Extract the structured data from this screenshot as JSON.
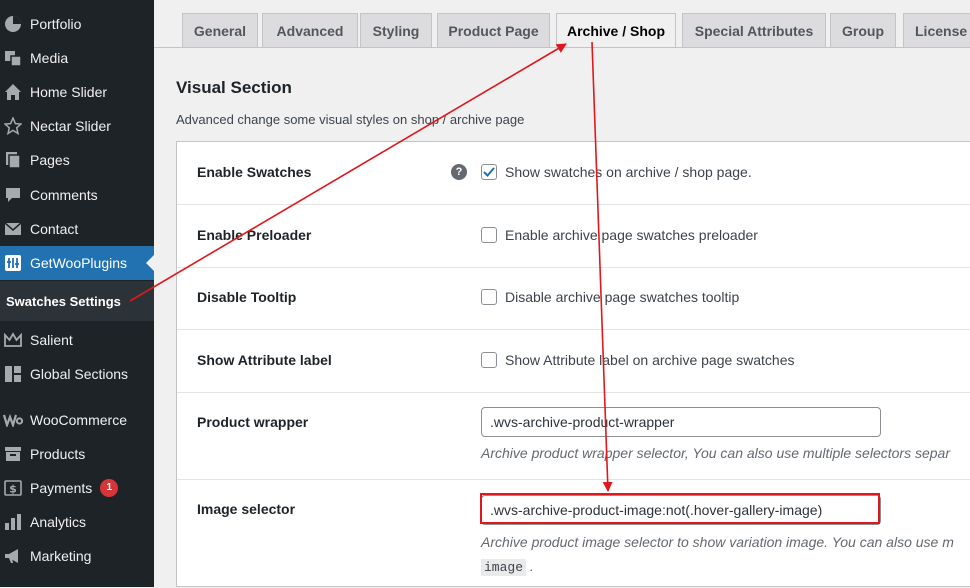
{
  "sidebar": {
    "items": [
      {
        "label": "Portfolio",
        "icon": "portfolio-icon"
      },
      {
        "label": "Media",
        "icon": "media-icon"
      },
      {
        "label": "Home Slider",
        "icon": "home-icon"
      },
      {
        "label": "Nectar Slider",
        "icon": "star-icon"
      },
      {
        "label": "Pages",
        "icon": "pages-icon"
      },
      {
        "label": "Comments",
        "icon": "comment-icon"
      },
      {
        "label": "Contact",
        "icon": "mail-icon"
      },
      {
        "label": "GetWooPlugins",
        "icon": "plugin-icon",
        "active": true
      },
      {
        "label": "Salient",
        "icon": "crown-icon"
      },
      {
        "label": "Global Sections",
        "icon": "layout-icon"
      },
      {
        "label": "WooCommerce",
        "icon": "woo-icon"
      },
      {
        "label": "Products",
        "icon": "archive-icon"
      },
      {
        "label": "Payments",
        "icon": "dollar-icon",
        "badge": "1"
      },
      {
        "label": "Analytics",
        "icon": "chart-icon"
      },
      {
        "label": "Marketing",
        "icon": "megaphone-icon"
      }
    ],
    "submenu_label": "Swatches Settings"
  },
  "tabs": [
    {
      "label": "General"
    },
    {
      "label": "Advanced"
    },
    {
      "label": "Styling"
    },
    {
      "label": "Product Page"
    },
    {
      "label": "Archive / Shop",
      "active": true
    },
    {
      "label": "Special Attributes"
    },
    {
      "label": "Group"
    },
    {
      "label": "License"
    }
  ],
  "section": {
    "title": "Visual Section",
    "description": "Advanced change some visual styles on shop / archive page"
  },
  "rows": {
    "enable_swatches": {
      "label": "Enable Swatches",
      "help": "?",
      "checkbox_label": "Show swatches on archive / shop page.",
      "checked": true
    },
    "enable_preloader": {
      "label": "Enable Preloader",
      "checkbox_label": "Enable archive page swatches preloader",
      "checked": false
    },
    "disable_tooltip": {
      "label": "Disable Tooltip",
      "checkbox_label": "Disable archive page swatches tooltip",
      "checked": false
    },
    "show_attribute_label": {
      "label": "Show Attribute label",
      "checkbox_label": "Show Attribute label on archive page swatches",
      "checked": false
    },
    "product_wrapper": {
      "label": "Product wrapper",
      "value": ".wvs-archive-product-wrapper",
      "description": "Archive product wrapper selector, You can also use multiple selectors separ"
    },
    "image_selector": {
      "label": "Image selector",
      "value": ".wvs-archive-product-image:not(.hover-gallery-image)",
      "description": "Archive product image selector to show variation image. You can also use m",
      "code_fragment": "image",
      "code_suffix": "."
    }
  },
  "colors": {
    "accent": "#2271b1",
    "sidebar_bg": "#1d2327",
    "annotation_red": "#e0181e",
    "badge_red": "#d63638"
  }
}
